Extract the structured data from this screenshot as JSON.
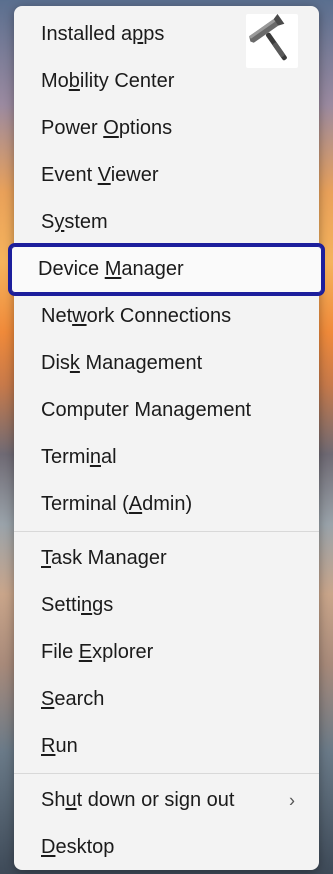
{
  "menu": {
    "groups": [
      [
        {
          "pre": "Installed a",
          "ul": "p",
          "post": "ps",
          "name": "menu-item-installed-apps"
        },
        {
          "pre": "Mo",
          "ul": "b",
          "post": "ility Center",
          "name": "menu-item-mobility-center"
        },
        {
          "pre": "Power ",
          "ul": "O",
          "post": "ptions",
          "name": "menu-item-power-options"
        },
        {
          "pre": "Event ",
          "ul": "V",
          "post": "iewer",
          "name": "menu-item-event-viewer"
        },
        {
          "pre": "S",
          "ul": "y",
          "post": "stem",
          "name": "menu-item-system"
        },
        {
          "pre": "Device ",
          "ul": "M",
          "post": "anager",
          "name": "menu-item-device-manager",
          "focused": true
        },
        {
          "pre": "Net",
          "ul": "w",
          "post": "ork Connections",
          "name": "menu-item-network-connections"
        },
        {
          "pre": "Dis",
          "ul": "k",
          "post": " Management",
          "name": "menu-item-disk-management"
        },
        {
          "pre": "Computer Mana",
          "ul": "g",
          "post": "ement",
          "name": "menu-item-computer-management"
        },
        {
          "pre": "Termi",
          "ul": "n",
          "post": "al",
          "name": "menu-item-terminal"
        },
        {
          "pre": "Terminal (",
          "ul": "A",
          "post": "dmin)",
          "name": "menu-item-terminal-admin"
        }
      ],
      [
        {
          "pre": "",
          "ul": "T",
          "post": "ask Manager",
          "name": "menu-item-task-manager"
        },
        {
          "pre": "Setti",
          "ul": "n",
          "post": "gs",
          "name": "menu-item-settings"
        },
        {
          "pre": "File ",
          "ul": "E",
          "post": "xplorer",
          "name": "menu-item-file-explorer"
        },
        {
          "pre": "",
          "ul": "S",
          "post": "earch",
          "name": "menu-item-search"
        },
        {
          "pre": "",
          "ul": "R",
          "post": "un",
          "name": "menu-item-run"
        }
      ],
      [
        {
          "pre": "Sh",
          "ul": "u",
          "post": "t down or sign out",
          "name": "menu-item-shut-down",
          "submenu": true
        },
        {
          "pre": "",
          "ul": "D",
          "post": "esktop",
          "name": "menu-item-desktop"
        }
      ]
    ],
    "submenu_chevron": "›",
    "focus_color": "#1c1e9c"
  },
  "logo": {
    "icon": "hammer-icon"
  }
}
